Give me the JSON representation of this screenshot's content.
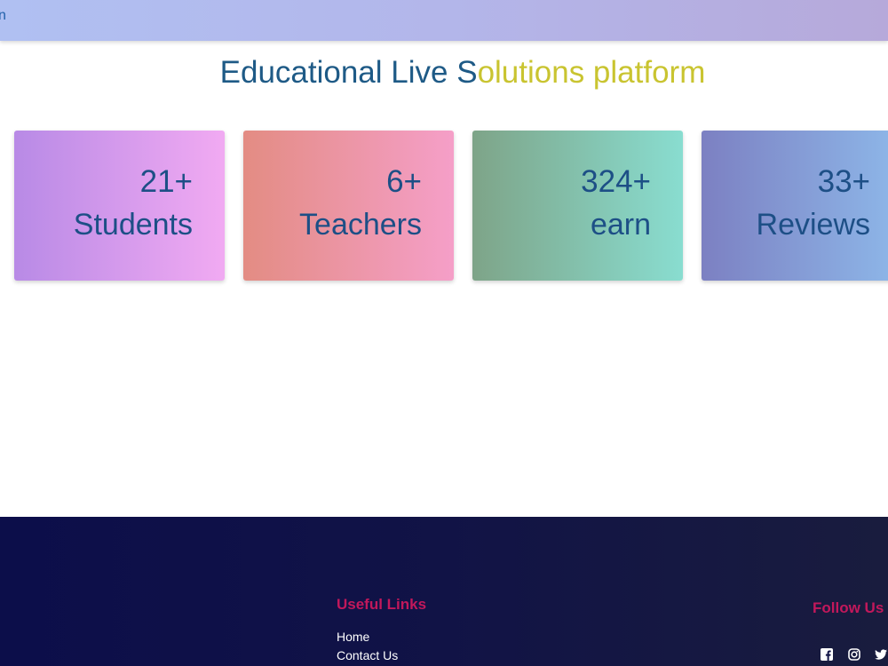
{
  "topbar": {
    "text": "n"
  },
  "headline": {
    "part1": "Educational Live S",
    "part2": "olutions platform"
  },
  "stats": [
    {
      "value": "21+",
      "label": "Students"
    },
    {
      "value": "6+",
      "label": "Teachers"
    },
    {
      "value": "324+",
      "label": "earn"
    },
    {
      "value": "33+",
      "label": "Reviews"
    }
  ],
  "footer": {
    "useful_links_title": "Useful Links",
    "links": [
      "Home",
      "Contact Us"
    ],
    "follow_title": "Follow Us",
    "social_icons": [
      "facebook-icon",
      "instagram-icon",
      "twitter-icon"
    ]
  },
  "colors": {
    "heading_blue": "#1e5a86",
    "heading_yellow": "#c9c430",
    "footer_title": "#c2185b",
    "footer_bg": "#0c0e4a"
  }
}
